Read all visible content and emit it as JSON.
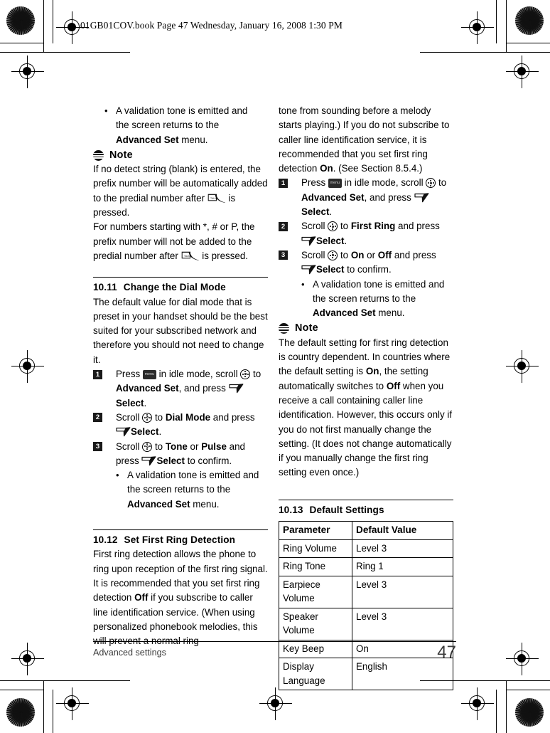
{
  "header": {
    "text": "01GB01COV.book  Page 47  Wednesday, January 16, 2008  1:30 PM"
  },
  "icons": {
    "menu_key_label": "menu",
    "nav_key": "navigation-key-icon",
    "soft_key": "left-soft-key-icon",
    "talk_key": "talk-key-icon",
    "note_icon": "note-icon"
  },
  "left_column": {
    "bullet_1": {
      "line1": "A validation tone is emitted and",
      "line2": "the screen returns to the",
      "bold": "Advanced Set",
      "tail": " menu."
    },
    "note": {
      "label": "Note",
      "para_1_a": "If no detect string (blank) is entered, the prefix number will be automatically added to the predial number after ",
      "para_1_b": " is pressed.",
      "para_2_a": "For numbers starting with *, # or P, the prefix number will not be added to the predial number after ",
      "para_2_b": " is pressed."
    },
    "section_10_11": {
      "number": "10.11",
      "title": "Change the Dial Mode",
      "intro": "The default value for dial mode that is preset in your handset should be the best suited for your subscribed network and therefore you should not need to change it.",
      "steps": [
        {
          "num": "1",
          "a": "Press ",
          "b": " in idle mode, scroll ",
          "c": " to ",
          "bold1": "Advanced Set",
          "d": ", and press ",
          "bold2": "Select",
          "e": "."
        },
        {
          "num": "2",
          "a": "Scroll ",
          "c": " to ",
          "bold1": "Dial Mode",
          "d": " and press ",
          "bold2": "Select",
          "e": "."
        },
        {
          "num": "3",
          "a": "Scroll ",
          "c": " to ",
          "bold1": "Tone",
          "mid": " or ",
          "bold2": "Pulse",
          "d": " and press ",
          "bold3": "Select",
          "e": " to confirm."
        }
      ],
      "bullet": {
        "line1": "A validation tone is emitted and",
        "line2": "the screen returns to the",
        "bold": "Advanced Set",
        "tail": " menu."
      }
    },
    "section_10_12": {
      "number": "10.12",
      "title": "Set First Ring Detection",
      "para_a": "First ring detection allows the phone to ring upon reception of the first ring signal. It is recommended that you set first ring detection ",
      "para_bold": "Off",
      "para_b": " if you subscribe to caller line identification service. (When using personalized phonebook melodies, this will prevent a normal ring"
    }
  },
  "right_column": {
    "continued": {
      "a": "tone from sounding before a melody starts playing.) If you do not subscribe to caller line identification service, it is recommended that you set first ring detection ",
      "bold": "On",
      "b": ". (See Section 8.5.4.)"
    },
    "steps": [
      {
        "num": "1",
        "a": "Press ",
        "b": " in idle mode, scroll ",
        "c": " to ",
        "bold1": "Advanced Set",
        "d": ", and press ",
        "bold2": "Select",
        "e": "."
      },
      {
        "num": "2",
        "a": "Scroll ",
        "c": " to ",
        "bold1": "First Ring",
        "d": " and press ",
        "bold2": "Select",
        "e": "."
      },
      {
        "num": "3",
        "a": "Scroll ",
        "c": " to ",
        "bold1": "On",
        "mid": " or ",
        "bold2": "Off",
        "d": " and press ",
        "bold3": "Select",
        "e": " to confirm."
      }
    ],
    "bullet": {
      "line1": "A validation tone is emitted and",
      "line2": "the screen returns to the",
      "bold": "Advanced Set",
      "tail": " menu."
    },
    "note": {
      "label": "Note",
      "a": "The default setting for first ring detection is country dependent. In countries where the default setting is ",
      "bold1": "On",
      "b": ", the setting automatically switches to ",
      "bold2": "Off",
      "c": " when you receive a call containing caller line identification. However, this occurs only if you do not first manually change the setting. (It does not change automatically if you manually change the first ring setting even once.)"
    },
    "section_10_13": {
      "number": "10.13",
      "title": "Default Settings",
      "table": {
        "headers": [
          "Parameter",
          "Default Value"
        ],
        "rows": [
          [
            "Ring Volume",
            "Level 3"
          ],
          [
            "Ring Tone",
            "Ring 1"
          ],
          [
            "Earpiece Volume",
            "Level 3"
          ],
          [
            "Speaker Volume",
            "Level 3"
          ],
          [
            "Key Beep",
            "On"
          ],
          [
            "Display Language",
            "English"
          ]
        ]
      }
    }
  },
  "footer": {
    "label": "Advanced settings",
    "page": "47"
  }
}
